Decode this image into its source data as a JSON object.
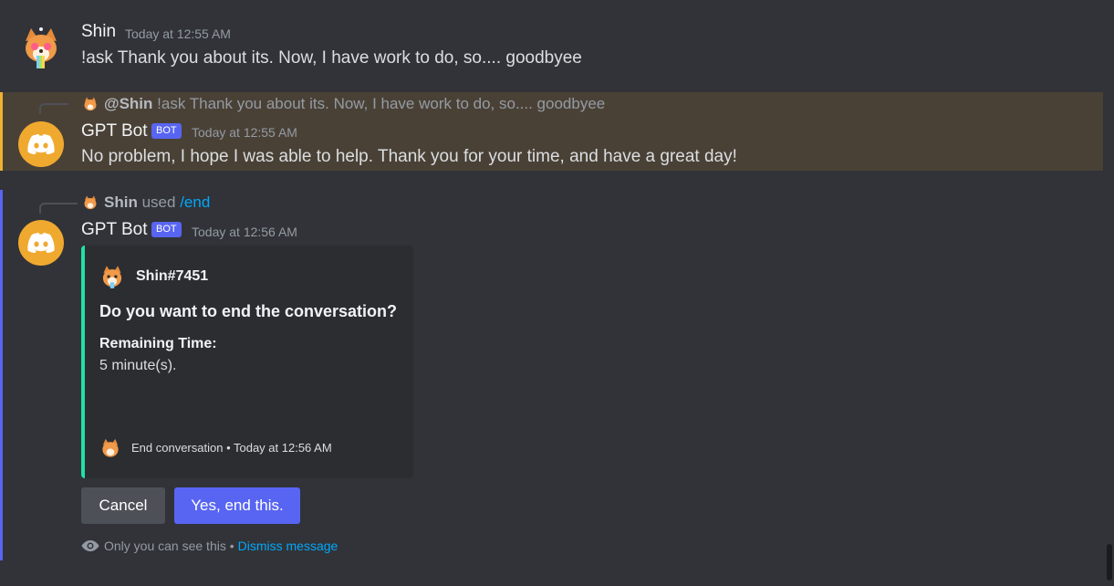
{
  "messages": {
    "user_msg": {
      "author": "Shin",
      "timestamp": "Today at 12:55 AM",
      "text": "!ask Thank you about its. Now, I have work to do, so.... goodbyee"
    },
    "bot_reply": {
      "reply_mention": "@Shin",
      "reply_text": "!ask Thank you about its. Now, I have work to do, so.... goodbyee",
      "author": "GPT Bot",
      "tag": "BOT",
      "timestamp": "Today at 12:55 AM",
      "text": "No problem, I hope I was able to help. Thank you for your time, and have a great day!"
    },
    "bot_end": {
      "command_user": "Shin",
      "command_used": "used",
      "command": "/end",
      "author": "GPT Bot",
      "tag": "BOT",
      "timestamp": "Today at 12:56 AM",
      "embed": {
        "author": "Shin#7451",
        "title": "Do you want to end the conversation?",
        "field_name": "Remaining Time:",
        "field_value": "5 minute(s).",
        "footer": "End conversation • Today at 12:56 AM",
        "accent_color": "#1fe1a8"
      },
      "buttons": {
        "cancel": "Cancel",
        "confirm": "Yes, end this."
      },
      "ephemeral": {
        "notice": "Only you can see this •",
        "dismiss": "Dismiss message"
      }
    }
  },
  "colors": {
    "background": "#313338",
    "highlight_mention": "#4a4136",
    "mention_bar": "#f0b232",
    "ephemeral_bar": "#5865f2",
    "blurple": "#5865f2",
    "bot_avatar": "#f0a92f"
  }
}
